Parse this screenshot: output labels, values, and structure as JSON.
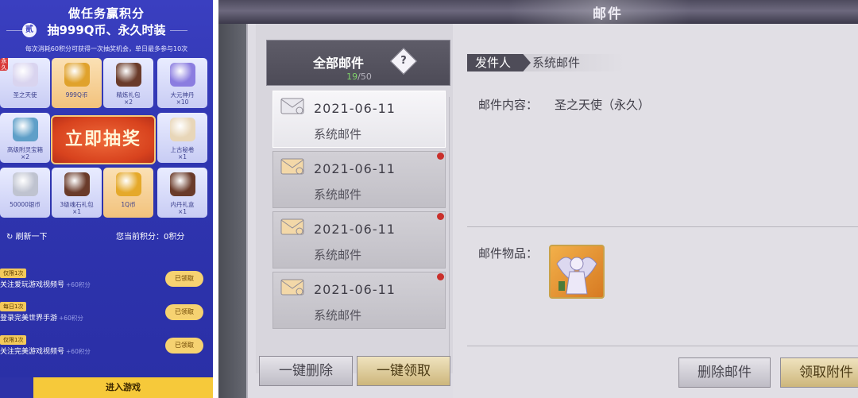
{
  "promo": {
    "title": "做任务赢积分",
    "subtitle_badge": "贰",
    "subtitle": "抽999Q币、永久时装",
    "note": "每次消耗60积分可获得一次抽奖机会，单日最多参与10次",
    "prizes": [
      {
        "label": "圣之天使",
        "tag": "永久",
        "icon": "angel-icon",
        "style": "light"
      },
      {
        "label": "999Q币",
        "icon": "coin-pile-icon",
        "style": "gold"
      },
      {
        "label": "精炼礼包\n×2",
        "icon": "chest-icon",
        "style": "light"
      },
      {
        "label": "大元神丹\n×10",
        "icon": "orb-icon",
        "style": "light"
      },
      {
        "label": "高级附灵宝箱\n×2",
        "icon": "box-icon",
        "style": "light"
      },
      {
        "label": "上古秘卷\n×1",
        "icon": "scroll-icon",
        "style": "light"
      },
      {
        "label": "50000银币",
        "icon": "silver-coin-icon",
        "style": "light"
      },
      {
        "label": "3级魂石礼包\n×1",
        "icon": "chest-icon",
        "style": "light"
      },
      {
        "label": "1Q币",
        "icon": "coin-icon",
        "style": "gold"
      },
      {
        "label": "内丹礼盒\n×1",
        "icon": "chest-icon",
        "style": "light"
      }
    ],
    "draw_button": "立即抽奖",
    "refresh": "刷新一下",
    "points": "您当前积分：0积分",
    "tasks": [
      {
        "badge": "仅限1次",
        "name": "关注爱玩游戏视频号",
        "points": "+60积分",
        "button": "已领取"
      },
      {
        "badge": "每日1次",
        "name": "登录完美世界手游",
        "points": "+60积分",
        "button": "已领取"
      },
      {
        "badge": "仅限1次",
        "name": "关注完美游戏视频号",
        "points": "+60积分",
        "button": "已领取"
      }
    ],
    "enter_button": "进入游戏",
    "colors": {
      "bg": "#3a3fc0",
      "gold": "#f6c93a",
      "draw": "#d8431e"
    }
  },
  "mail": {
    "window_title": "邮件",
    "list_title": "全部邮件",
    "help_icon": "?",
    "count_current": "19",
    "count_total": "/50",
    "items": [
      {
        "date": "2021-06-11",
        "from": "系统邮件",
        "selected": true,
        "unread": false
      },
      {
        "date": "2021-06-11",
        "from": "系统邮件",
        "selected": false,
        "unread": true
      },
      {
        "date": "2021-06-11",
        "from": "系统邮件",
        "selected": false,
        "unread": true
      },
      {
        "date": "2021-06-11",
        "from": "系统邮件",
        "selected": false,
        "unread": true
      }
    ],
    "delete_all": "一键删除",
    "claim_all": "一键领取",
    "sender_label": "发件人",
    "sender_value": "系统邮件",
    "content_label": "邮件内容：",
    "content_value": "圣之天使（永久）",
    "items_label": "邮件物品：",
    "delete_mail": "删除邮件",
    "claim_attachment": "领取附件",
    "colors": {
      "unread_dot": "#c9302c",
      "count": "#7fd36a"
    }
  }
}
